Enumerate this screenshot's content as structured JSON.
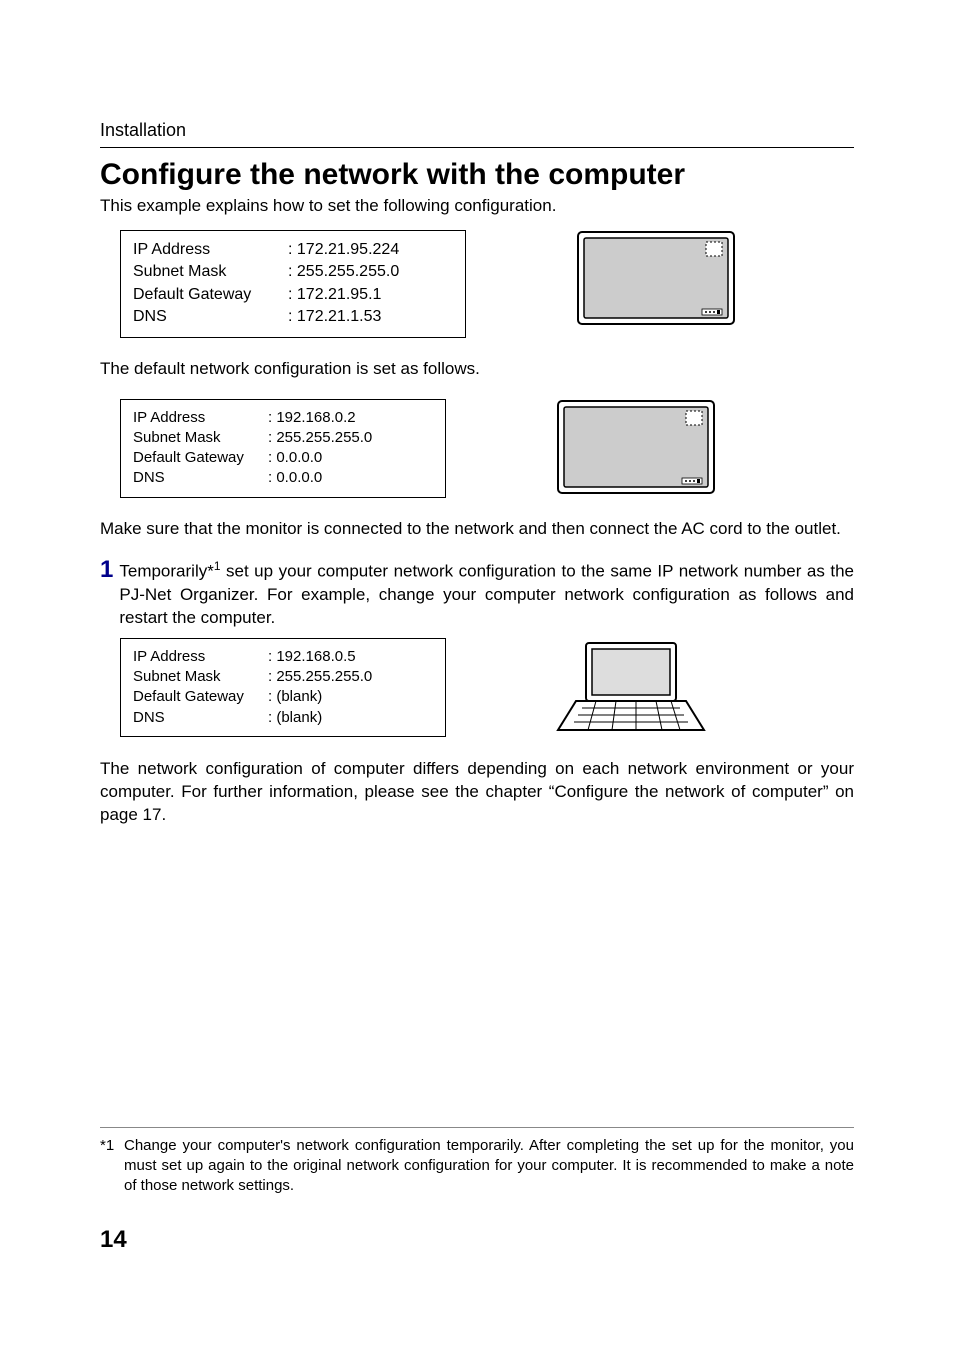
{
  "header": {
    "section": "Installation"
  },
  "title": "Configure the network with the computer",
  "intro": "This example explains how to set the following configuration.",
  "config_target": {
    "ip_label": "IP Address",
    "ip_value": "172.21.95.224",
    "mask_label": "Subnet Mask",
    "mask_value": "255.255.255.0",
    "gw_label": "Default Gateway",
    "gw_value": "172.21.95.1",
    "dns_label": "DNS",
    "dns_value": "172.21.1.53"
  },
  "default_intro": "The default network configuration is set as follows.",
  "config_default": {
    "ip_label": "IP Address",
    "ip_value": "192.168.0.2",
    "mask_label": "Subnet Mask",
    "mask_value": "255.255.255.0",
    "gw_label": "Default Gateway",
    "gw_value": "0.0.0.0",
    "dns_label": "DNS",
    "dns_value": "0.0.0.0"
  },
  "make_sure_text": "Make sure that the monitor is connected to the network and then connect the AC cord to the outlet.",
  "step1": {
    "number": "1",
    "text_a": "Temporarily*",
    "text_sup": "1",
    "text_b": " set up your computer network configuration to the same IP network number as the PJ-Net Organizer. For example, change your computer network configuration as follows and restart the computer."
  },
  "config_computer": {
    "ip_label": "IP Address",
    "ip_value": "192.168.0.5",
    "mask_label": "Subnet Mask",
    "mask_value": "255.255.255.0",
    "gw_label": "Default Gateway",
    "gw_value": "(blank)",
    "dns_label": "DNS",
    "dns_value": "(blank)"
  },
  "closing_text": "The network configuration of computer differs depending on each network environment or your computer. For further information, please see the chapter “Configure the network of computer” on page 17.",
  "footnote": {
    "marker": "*1",
    "text": "Change your computer's network configuration temporarily. After completing the set up for the monitor, you must set up again to the original network configuration for your computer. It is recommended to make a note of those network settings."
  },
  "page_number": "14"
}
